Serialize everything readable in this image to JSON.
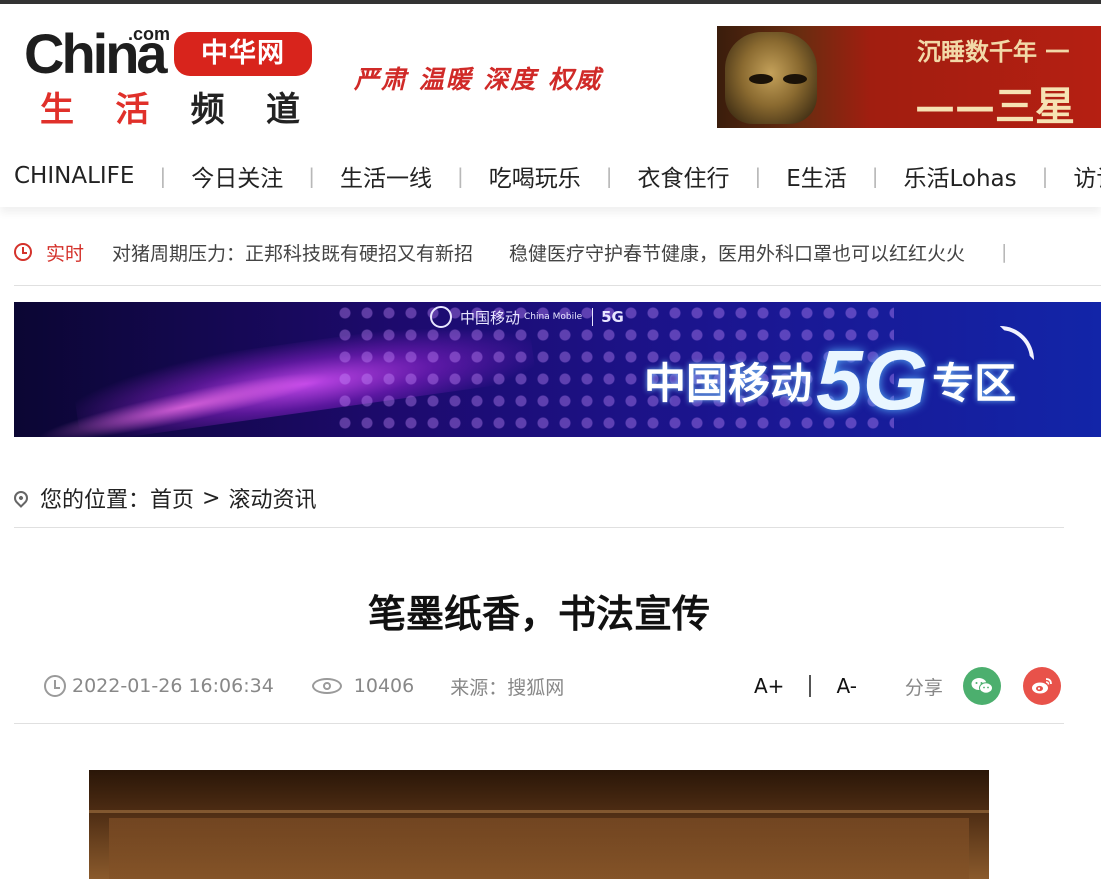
{
  "header": {
    "logo": {
      "main": "China",
      "com": ".com",
      "badge": "中华网",
      "channel": [
        "生",
        "活",
        "频",
        "道"
      ]
    },
    "slogan": "严肃 温暖 深度 权威",
    "ad": {
      "line1": "沉睡数千年 一",
      "line2": "——三星"
    }
  },
  "nav": {
    "items": [
      "CHINALIFE",
      "今日关注",
      "生活一线",
      "吃喝玩乐",
      "衣食住行",
      "E生活",
      "乐活Lohas",
      "访谈"
    ],
    "separator": "|"
  },
  "ticker": {
    "label": "实时",
    "items": [
      "对猪周期压力：正邦科技既有硬招又有新招",
      "稳健医疗守护春节健康，医用外科口罩也可以红红火火"
    ],
    "trailing": "|"
  },
  "banner": {
    "brand": "中国移动",
    "brand_en": "China Mobile",
    "badge_5g": "5G",
    "headline_pre": "中国移动",
    "headline_5g": "5G",
    "headline_post": "专区"
  },
  "breadcrumb": {
    "prefix": "您的位置：",
    "home": "首页",
    "separator": ">",
    "current": "滚动资讯"
  },
  "article": {
    "title": "笔墨纸香，书法宣传",
    "datetime": "2022-01-26 16:06:34",
    "views": "10406",
    "source": "来源：搜狐网"
  },
  "tools": {
    "font_up": "A+",
    "font_down": "A-",
    "share_label": "分享",
    "share_targets": [
      "wechat-icon",
      "weibo-icon"
    ]
  },
  "colors": {
    "brand_red": "#d8241c",
    "ticker_red": "#d4322b",
    "wechat_green": "#4caf6e",
    "weibo_red": "#e8524a"
  }
}
